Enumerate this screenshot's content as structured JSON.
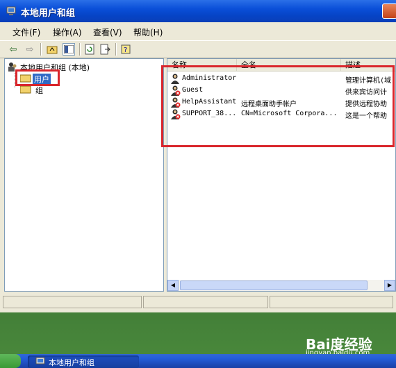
{
  "window": {
    "title": "本地用户和组"
  },
  "menu": [
    "文件(F)",
    "操作(A)",
    "查看(V)",
    "帮助(H)"
  ],
  "tree": {
    "root": "本地用户和组 (本地)",
    "children": [
      "用户",
      "组"
    ]
  },
  "columns": [
    "名称",
    "全名",
    "描述"
  ],
  "users": [
    {
      "name": "Administrator",
      "fullname": "",
      "description": "管理计算机(域",
      "icon": "user-icon"
    },
    {
      "name": "Guest",
      "fullname": "",
      "description": "供来宾访问计",
      "icon": "user-disabled-icon"
    },
    {
      "name": "HelpAssistant",
      "fullname": "远程桌面助手帐户",
      "description": "提供远程协助",
      "icon": "user-disabled-icon"
    },
    {
      "name": "SUPPORT_38...",
      "fullname": "CN=Microsoft Corpora...",
      "description": "这是一个帮助",
      "icon": "user-disabled-icon"
    }
  ],
  "taskbar": {
    "item": "本地用户和组"
  },
  "watermark": {
    "logo": "Bai度经验",
    "url": "jingyan.baidu.com"
  },
  "colors": {
    "highlight": "#d9262c",
    "xp_blue": "#0a4fd8"
  }
}
